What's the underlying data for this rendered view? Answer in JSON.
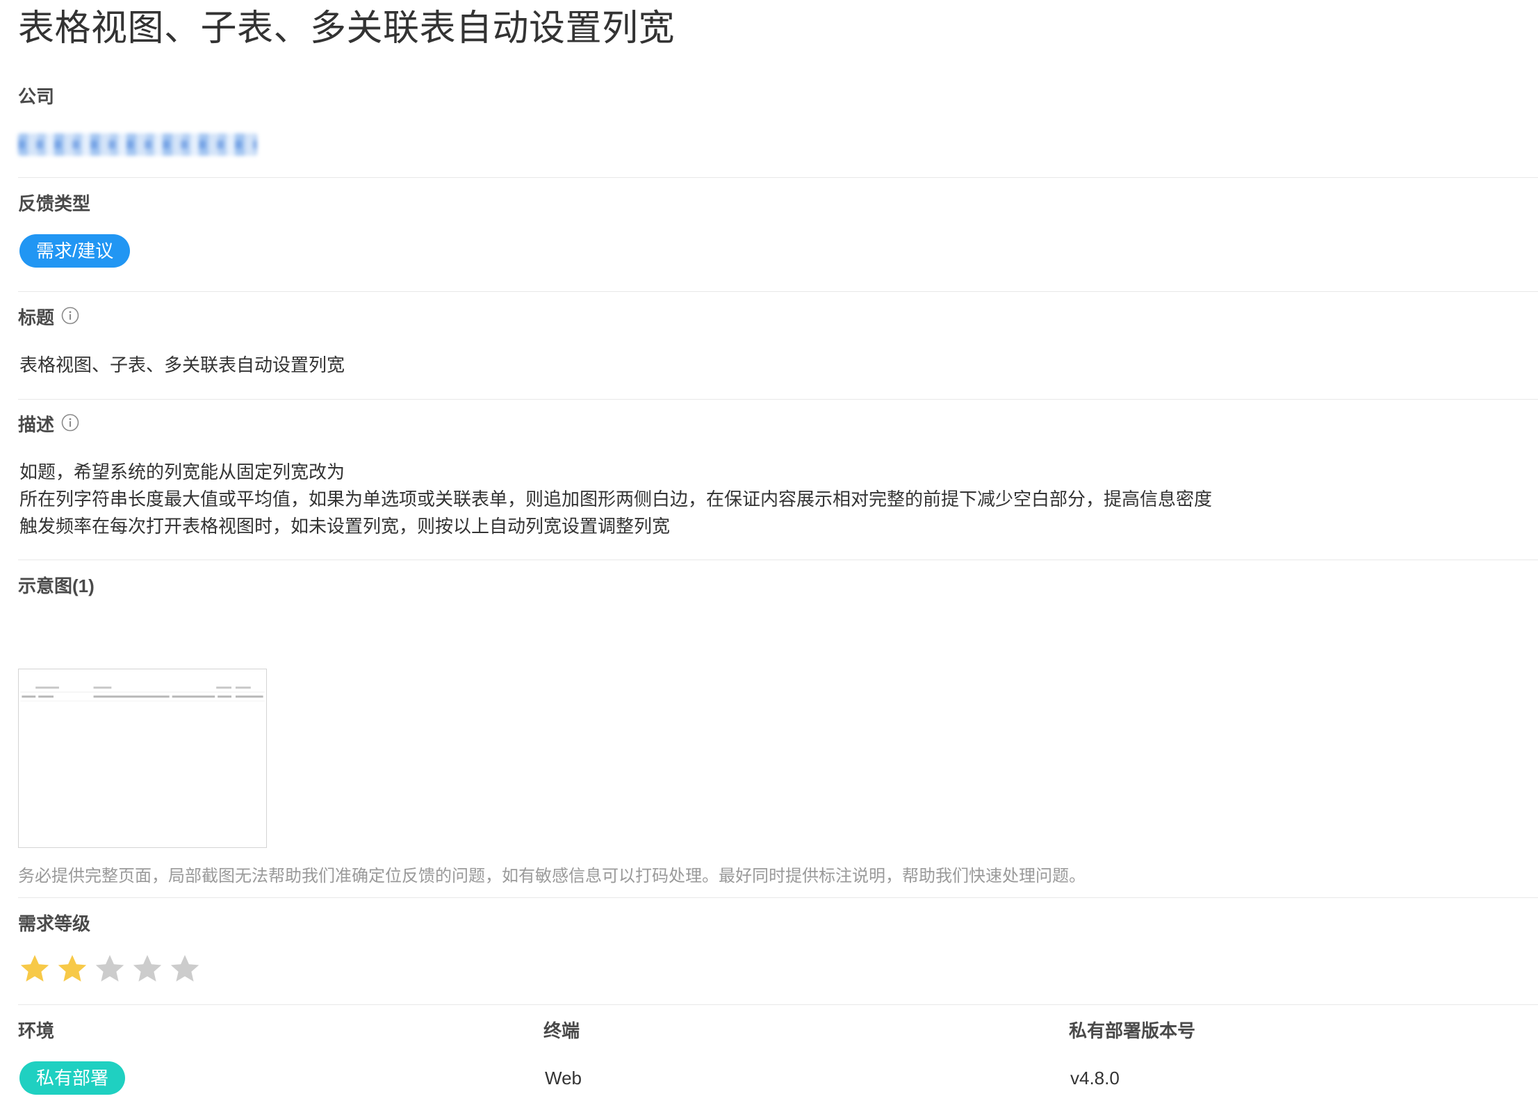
{
  "page_title": "表格视图、子表、多关联表自动设置列宽",
  "company": {
    "label": "公司"
  },
  "feedback_type": {
    "label": "反馈类型",
    "value": "需求/建议",
    "tag_color": "#2196f3"
  },
  "title_field": {
    "label": "标题",
    "info_icon": "info-circle-icon",
    "value": "表格视图、子表、多关联表自动设置列宽"
  },
  "description": {
    "label": "描述",
    "info_icon": "info-circle-icon",
    "lines": [
      "如题，希望系统的列宽能从固定列宽改为",
      "所在列字符串长度最大值或平均值，如果为单选项或关联表单，则追加图形两侧白边，在保证内容展示相对完整的前提下减少空白部分，提高信息密度",
      "触发频率在每次打开表格视图时，如未设置列宽，则按以上自动列宽设置调整列宽"
    ]
  },
  "screenshots": {
    "label": "示意图(1)",
    "hint": "务必提供完整页面，局部截图无法帮助我们准确定位反馈的问题，如有敏感信息可以打码处理。最好同时提供标注说明，帮助我们快速处理问题。"
  },
  "priority": {
    "label": "需求等级",
    "rating": 2,
    "max": 5,
    "active_color": "#f7c948",
    "inactive_color": "#cccccc"
  },
  "environment": {
    "label": "环境",
    "value": "私有部署",
    "tag_color": "#1fd0c1"
  },
  "terminal": {
    "label": "终端",
    "value": "Web"
  },
  "version": {
    "label": "私有部署版本号",
    "value": "v4.8.0"
  }
}
